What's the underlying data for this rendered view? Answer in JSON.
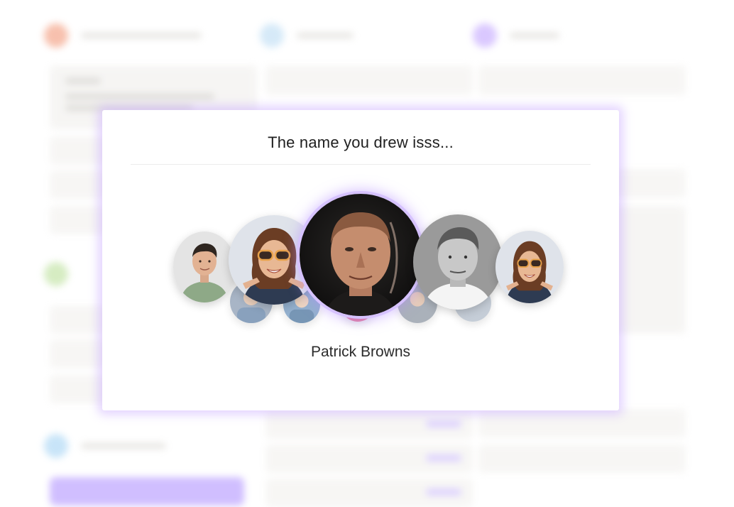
{
  "modal": {
    "title": "The name you drew isss...",
    "winner_name": "Patrick Browns"
  },
  "avatars": [
    {
      "role": "far-left",
      "icon": "person-avatar-icon"
    },
    {
      "role": "left",
      "icon": "person-avatar-icon"
    },
    {
      "role": "selected",
      "icon": "person-avatar-icon"
    },
    {
      "role": "right",
      "icon": "person-avatar-icon"
    },
    {
      "role": "far-right",
      "icon": "person-avatar-icon"
    }
  ],
  "colors": {
    "accent": "#b48cff",
    "modal_glow": "#c4a0ff",
    "selected_ring": "#d6c2ff"
  }
}
